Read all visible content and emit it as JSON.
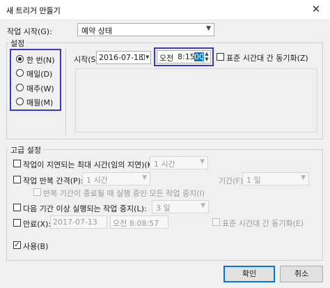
{
  "window": {
    "title": "새 트리거 만들기",
    "close_glyph": "✕"
  },
  "start_task": {
    "label": "작업 시작(G):",
    "value": "예약 상태"
  },
  "settings": {
    "group_title": "설정",
    "radios": [
      {
        "label": "한 번(N)",
        "selected": true
      },
      {
        "label": "매일(D)",
        "selected": false
      },
      {
        "label": "매주(W)",
        "selected": false
      },
      {
        "label": "매월(M)",
        "selected": false
      }
    ],
    "start_label": "시작(S):",
    "start_date": "2016-07-13",
    "time_prefix": "오전",
    "time_main": "8:15:",
    "time_selected": "00",
    "sync_label": "표준 시간대 간 동기화(Z)"
  },
  "advanced": {
    "group_title": "고급 설정",
    "delay": {
      "label": "작업이 지연되는 최대 시간(임의 지연)(K):",
      "value": "1 시간"
    },
    "repeat": {
      "label": "작업 반복 간격(P):",
      "value": "1 시간",
      "duration_label": "기간(F):",
      "duration_value": "1 일"
    },
    "stop_all": {
      "label": "반복 기간이 종료될 때 실행 중인 모든 작업 중지(I)"
    },
    "stop_longer": {
      "label": "다음 기간 이상 실행되는 작업 중지(L):",
      "value": "3 일"
    },
    "expire": {
      "label": "만료(X):",
      "date": "2017-07-13",
      "time": "오전   8:08:57",
      "sync_label": "표준 시간대 간 동기화(E)"
    },
    "enabled": {
      "label": "사용(B)",
      "checked_glyph": "✓"
    }
  },
  "buttons": {
    "ok": "확인",
    "cancel": "취소"
  },
  "icons": {
    "calendar": "calendar-icon",
    "dropdown": "chevron-down-icon"
  },
  "colors": {
    "highlight": "#3b3bb8",
    "accent": "#0078d7"
  }
}
